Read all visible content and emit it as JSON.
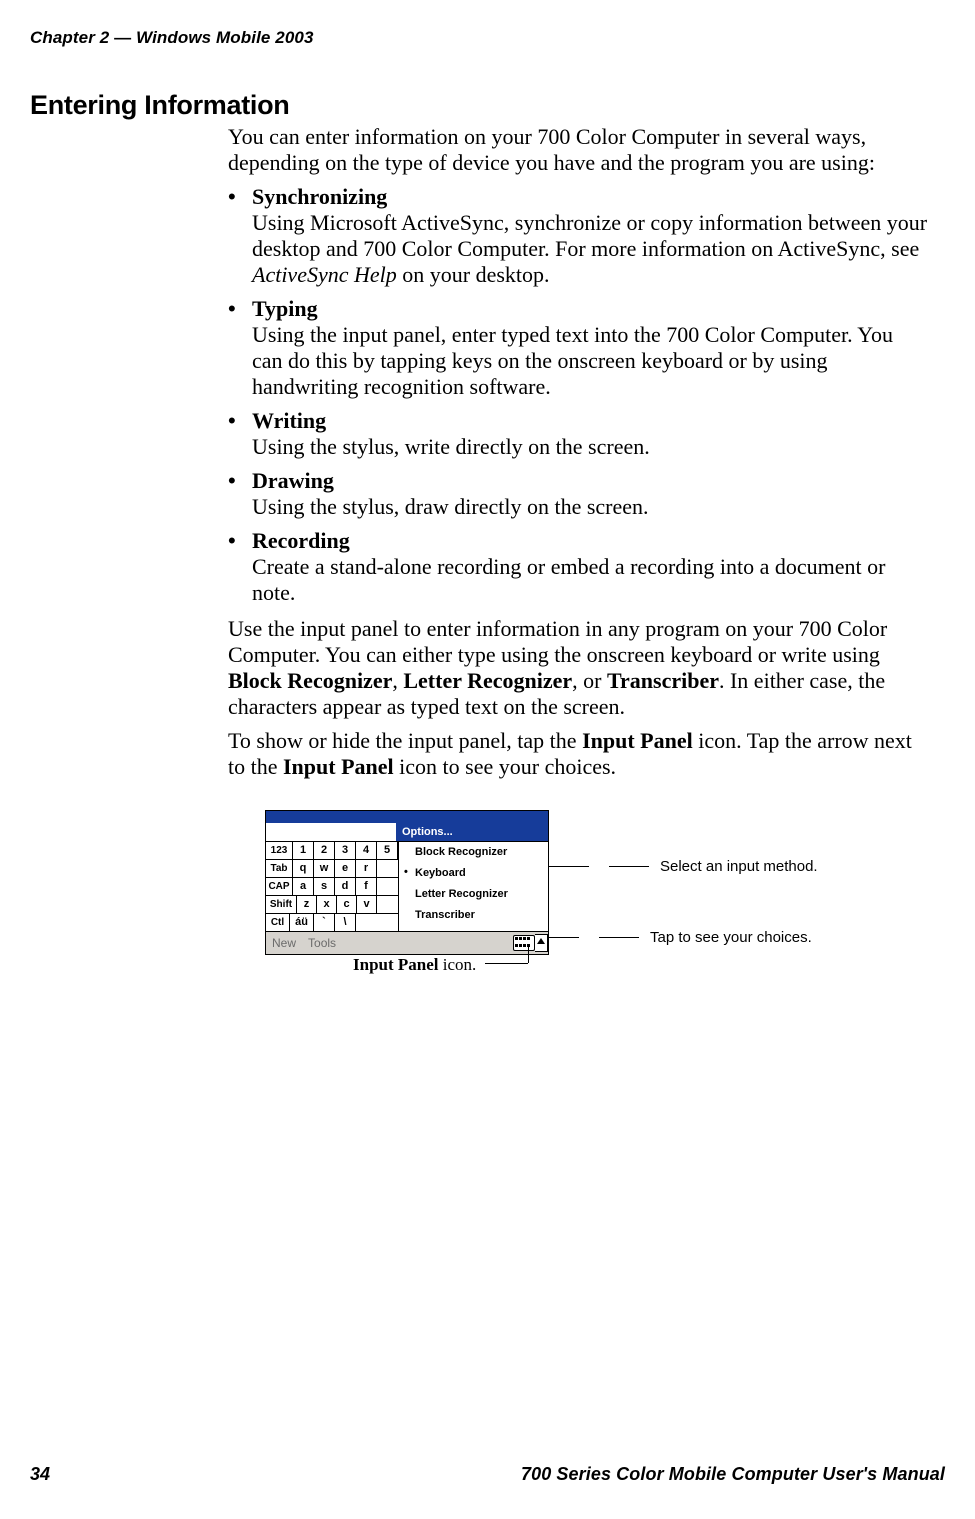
{
  "header": {
    "chapter": "Chapter 2",
    "sep": "—",
    "title": "Windows Mobile 2003"
  },
  "h1": "Entering Information",
  "intro": "You can enter information on your 700 Color Computer in several ways, depending on the type of device you have and the program you are using:",
  "bullets": [
    {
      "term": "Synchronizing",
      "body_pre": "Using Microsoft ActiveSync, synchronize or copy information between your desktop and 700 Color Computer. For more information on ActiveSync, see ",
      "body_italic": "ActiveSync Help",
      "body_post": " on your desktop."
    },
    {
      "term": "Typing",
      "body": "Using the input panel, enter typed text into the 700 Color Computer. You can do this by tapping keys on the onscreen keyboard or by using handwriting recognition software."
    },
    {
      "term": "Writing",
      "body": "Using the stylus, write directly on the screen."
    },
    {
      "term": "Drawing",
      "body": "Using the stylus, draw directly on the screen."
    },
    {
      "term": "Recording",
      "body": "Create a stand-alone recording or embed a recording into a document or note."
    }
  ],
  "p2": {
    "t1": "Use the input panel to enter information in any program on your 700 Color Computer. You can either type using the onscreen keyboard or write using ",
    "b1": "Block Recognizer",
    "t2": ", ",
    "b2": "Letter Recognizer",
    "t3": ", or ",
    "b3": "Transcriber",
    "t4": ". In either case, the characters appear as typed text on the screen."
  },
  "p3": {
    "t1": "To show or hide the input panel, tap the ",
    "b1": "Input Panel",
    "t2": " icon. Tap the arrow next to the ",
    "b2": "Input Panel",
    "t3": " icon to see your choices."
  },
  "screenshot": {
    "options": "Options...",
    "row1": [
      "123",
      "1",
      "2",
      "3",
      "4",
      "5"
    ],
    "row2": [
      "Tab",
      "q",
      "w",
      "e",
      "r"
    ],
    "row3": [
      "CAP",
      "a",
      "s",
      "d",
      "f"
    ],
    "row4": [
      "Shift",
      "z",
      "x",
      "c",
      "v"
    ],
    "row5": [
      "Ctl",
      "áü",
      "`",
      "\\"
    ],
    "menu": [
      "Block Recognizer",
      "Keyboard",
      "Letter Recognizer",
      "Transcriber"
    ],
    "menu_selected_index": 1,
    "bar": {
      "new": "New",
      "tools": "Tools"
    }
  },
  "callouts": {
    "select": "Select an input method.",
    "tap": "Tap to see your choices.",
    "icon_label_bold": "Input Panel",
    "icon_label_rest": " icon."
  },
  "footer": {
    "page": "34",
    "manual": "700 Series Color Mobile Computer User's Manual"
  }
}
